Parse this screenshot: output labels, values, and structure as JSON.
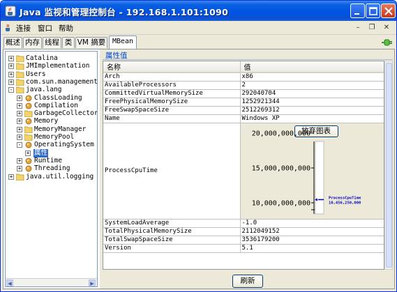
{
  "window": {
    "title": "Java 监视和管理控制台 - 192.168.1.101:1090"
  },
  "menu": {
    "connect": "连接",
    "window": "窗口",
    "help": "帮助"
  },
  "tabs": [
    "概述",
    "内存",
    "线程",
    "类",
    "VM 摘要",
    "MBean"
  ],
  "tree": [
    {
      "label": "Catalina",
      "level": 0,
      "toggle": "+",
      "icon": "folder-icon"
    },
    {
      "label": "JMImplementation",
      "level": 0,
      "toggle": "+",
      "icon": "folder-icon"
    },
    {
      "label": "Users",
      "level": 0,
      "toggle": "+",
      "icon": "folder-icon"
    },
    {
      "label": "com.sun.management",
      "level": 0,
      "toggle": "+",
      "icon": "folder-icon"
    },
    {
      "label": "java.lang",
      "level": 0,
      "toggle": "-",
      "icon": "folder-icon"
    },
    {
      "label": "ClassLoading",
      "level": 1,
      "toggle": "+",
      "icon": "bean-icon"
    },
    {
      "label": "Compilation",
      "level": 1,
      "toggle": "+",
      "icon": "bean-icon"
    },
    {
      "label": "GarbageCollector",
      "level": 1,
      "toggle": "+",
      "icon": "folder-icon"
    },
    {
      "label": "Memory",
      "level": 1,
      "toggle": "+",
      "icon": "bean-icon"
    },
    {
      "label": "MemoryManager",
      "level": 1,
      "toggle": "+",
      "icon": "folder-icon"
    },
    {
      "label": "MemoryPool",
      "level": 1,
      "toggle": "+",
      "icon": "folder-icon"
    },
    {
      "label": "OperatingSystem",
      "level": 1,
      "toggle": "-",
      "icon": "bean-icon"
    },
    {
      "label": "属性",
      "level": 2,
      "toggle": "+",
      "icon": "",
      "selected": true
    },
    {
      "label": "Runtime",
      "level": 1,
      "toggle": "+",
      "icon": "bean-icon"
    },
    {
      "label": "Threading",
      "level": 1,
      "toggle": "+",
      "icon": "bean-icon"
    },
    {
      "label": "java.util.logging",
      "level": 0,
      "toggle": "+",
      "icon": "folder-icon"
    }
  ],
  "attributes": {
    "title": "属性值",
    "col_name": "名称",
    "col_value": "值",
    "rows_before": [
      {
        "name": "Arch",
        "value": "x86"
      },
      {
        "name": "AvailableProcessors",
        "value": "2"
      },
      {
        "name": "CommittedVirtualMemorySize",
        "value": "292040704"
      },
      {
        "name": "FreePhysicalMemorySize",
        "value": "1252921344"
      },
      {
        "name": "FreeSwapSpaceSize",
        "value": "2512269312"
      },
      {
        "name": "Name",
        "value": "Windows XP"
      }
    ],
    "cpu_row": {
      "name": "ProcessCpuTime",
      "button": "放弃图表"
    },
    "rows_after": [
      {
        "name": "SystemLoadAverage",
        "value": "-1.0"
      },
      {
        "name": "TotalPhysicalMemorySize",
        "value": "2112049152"
      },
      {
        "name": "TotalSwapSpaceSize",
        "value": "3536179200"
      },
      {
        "name": "Version",
        "value": "5.1"
      }
    ]
  },
  "chart_data": {
    "type": "line",
    "y_ticks": [
      "20,000,000,000",
      "15,000,000,000",
      "10,000,000,000"
    ],
    "ylim": [
      8000000000,
      21000000000
    ],
    "series": [
      {
        "name": "ProcessCpuTime",
        "current_label": "10,456,250,000",
        "values": [
          10456250000
        ],
        "color": "#0000c0"
      }
    ]
  },
  "refresh": "刷新",
  "colors": {
    "title_bar": "#0054e3",
    "selected": "#316ac5",
    "series": "#0000c0"
  }
}
